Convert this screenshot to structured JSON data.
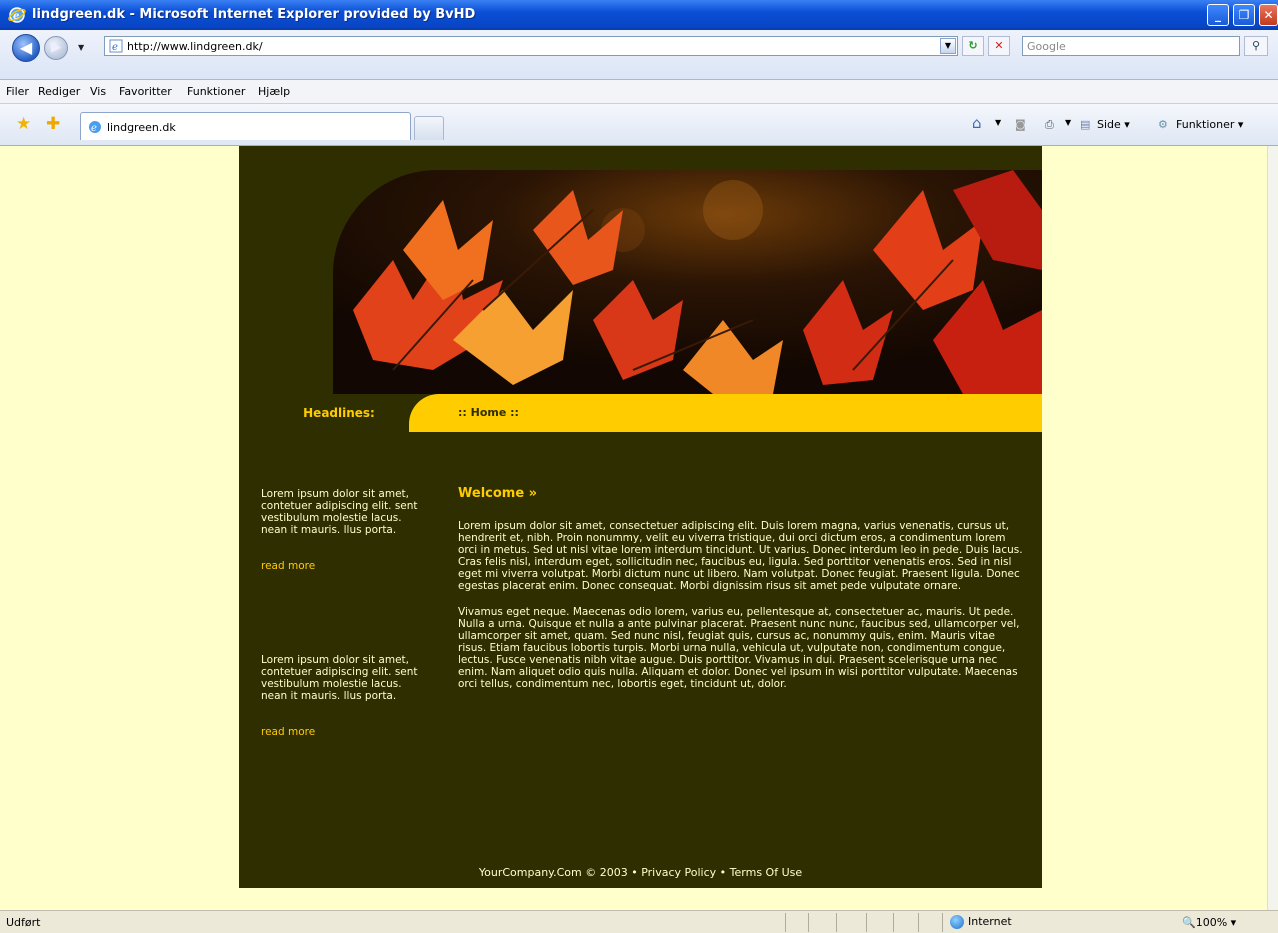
{
  "window": {
    "title": "lindgreen.dk - Microsoft Internet Explorer provided by BvHD"
  },
  "navigation": {
    "back_glyph": "◀",
    "forward_glyph": "▶",
    "url": "http://www.lindgreen.dk/",
    "refresh_glyph": "↻",
    "stop_glyph": "✕",
    "search_placeholder": "Google"
  },
  "menu": {
    "items": [
      "Filer",
      "Rediger",
      "Vis",
      "Favoritter",
      "Funktioner",
      "Hjælp"
    ]
  },
  "tabs": {
    "active_label": "lindgreen.dk"
  },
  "command_bar": {
    "page_label": "Side ▾",
    "tools_label": "Funktioner ▾"
  },
  "site": {
    "headlines_label": "Headlines:",
    "nav_home": ":: Home ::",
    "sidebar": [
      {
        "text": "Lorem ipsum dolor sit amet, contetuer adipiscing elit. sent vestibulum molestie lacus. nean it mauris. llus porta.",
        "link": "read more"
      },
      {
        "text": "Lorem ipsum dolor sit amet, contetuer adipiscing elit. sent vestibulum molestie lacus. nean it mauris. llus porta.",
        "link": "read more"
      }
    ],
    "welcome_heading": "Welcome »",
    "paragraphs": [
      "Lorem ipsum dolor sit amet, consectetuer adipiscing elit. Duis lorem magna, varius venenatis, cursus ut, hendrerit et, nibh. Proin nonummy, velit eu viverra tristique, dui orci dictum eros, a condimentum lorem orci in metus. Sed ut nisl vitae lorem interdum tincidunt. Ut varius. Donec interdum leo in pede. Duis lacus. Cras felis nisl, interdum eget, sollicitudin nec, faucibus eu, ligula. Sed porttitor venenatis eros. Sed in nisl eget mi viverra volutpat. Morbi dictum nunc ut libero. Nam volutpat. Donec feugiat. Praesent ligula. Donec egestas placerat enim. Donec consequat. Morbi dignissim risus sit amet pede vulputate ornare.",
      "Vivamus eget neque. Maecenas odio lorem, varius eu, pellentesque at, consectetuer ac, mauris. Ut pede. Nulla a urna. Quisque et nulla a ante pulvinar placerat. Praesent nunc nunc, faucibus sed, ullamcorper vel, ullamcorper sit amet, quam. Sed nunc nisl, feugiat quis, cursus ac, nonummy quis, enim. Mauris vitae risus. Etiam faucibus lobortis turpis. Morbi urna nulla, vehicula ut, vulputate non, condimentum congue, lectus. Fusce venenatis nibh vitae augue. Duis porttitor. Vivamus in dui. Praesent scelerisque urna nec enim. Nam aliquet odio quis nulla. Aliquam et dolor. Donec vel ipsum in wisi porttitor vulputate. Maecenas orci tellus, condimentum nec, lobortis eget, tincidunt ut, dolor."
    ],
    "footer": "YourCompany.Com © 2003 • Privacy Policy • Terms Of Use"
  },
  "status": {
    "text": "Udført",
    "zone": "Internet",
    "zoom": "100%"
  },
  "colors": {
    "site_background": "#2f2e00",
    "accent_yellow": "#ffcc00",
    "page_background": "#ffffcc"
  }
}
